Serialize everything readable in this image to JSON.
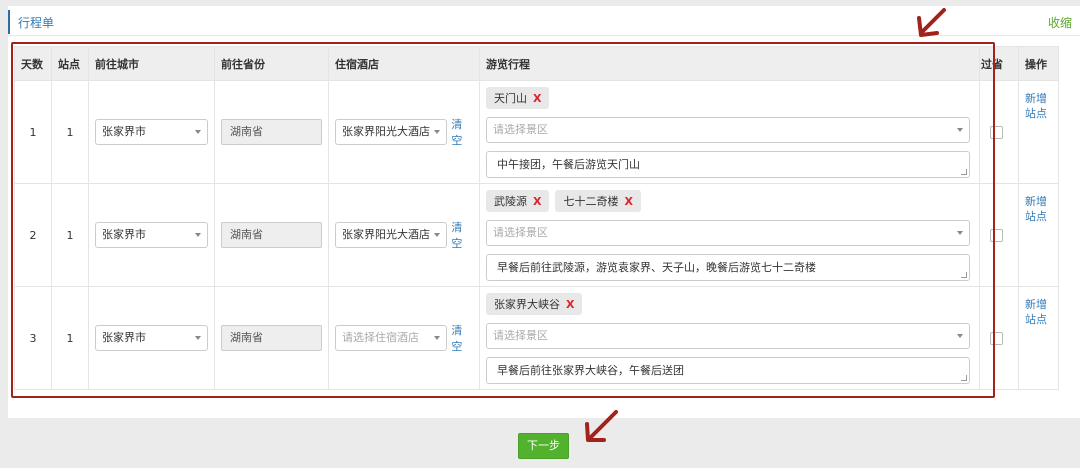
{
  "panel": {
    "title": "行程单",
    "collapse_label": "收缩"
  },
  "table": {
    "columns": [
      "天数",
      "站点",
      "前往城市",
      "前往省份",
      "住宿酒店",
      "游览行程",
      "过省",
      "操作"
    ],
    "rows": [
      {
        "day": "1",
        "station": "1",
        "city": "张家界市",
        "province": "湖南省",
        "hotel": "张家界阳光大酒店",
        "hotel_is_placeholder": false,
        "clear_label": "清空",
        "tags": [
          "天门山"
        ],
        "scenic_placeholder": "请选择景区",
        "itinerary": "中午接团，午餐后游览天门山",
        "add_label_line1": "新增",
        "add_label_line2": "站点"
      },
      {
        "day": "2",
        "station": "1",
        "city": "张家界市",
        "province": "湖南省",
        "hotel": "张家界阳光大酒店",
        "hotel_is_placeholder": false,
        "clear_label": "清空",
        "tags": [
          "武陵源",
          "七十二奇楼"
        ],
        "scenic_placeholder": "请选择景区",
        "itinerary": "早餐后前往武陵源，游览袁家界、天子山，晚餐后游览七十二奇楼",
        "add_label_line1": "新增",
        "add_label_line2": "站点"
      },
      {
        "day": "3",
        "station": "1",
        "city": "张家界市",
        "province": "湖南省",
        "hotel": "请选择住宿酒店",
        "hotel_is_placeholder": true,
        "clear_label": "清空",
        "tags": [
          "张家界大峡谷"
        ],
        "scenic_placeholder": "请选择景区",
        "itinerary": "早餐后前往张家界大峡谷，午餐后送团",
        "add_label_line1": "新增",
        "add_label_line2": "站点"
      }
    ]
  },
  "footer": {
    "next_label": "下一步"
  },
  "colors": {
    "accent_blue": "#337ab7",
    "annotation_red": "#a3221c",
    "next_green": "#52b22d",
    "tag_remove_red": "#d9232d"
  }
}
